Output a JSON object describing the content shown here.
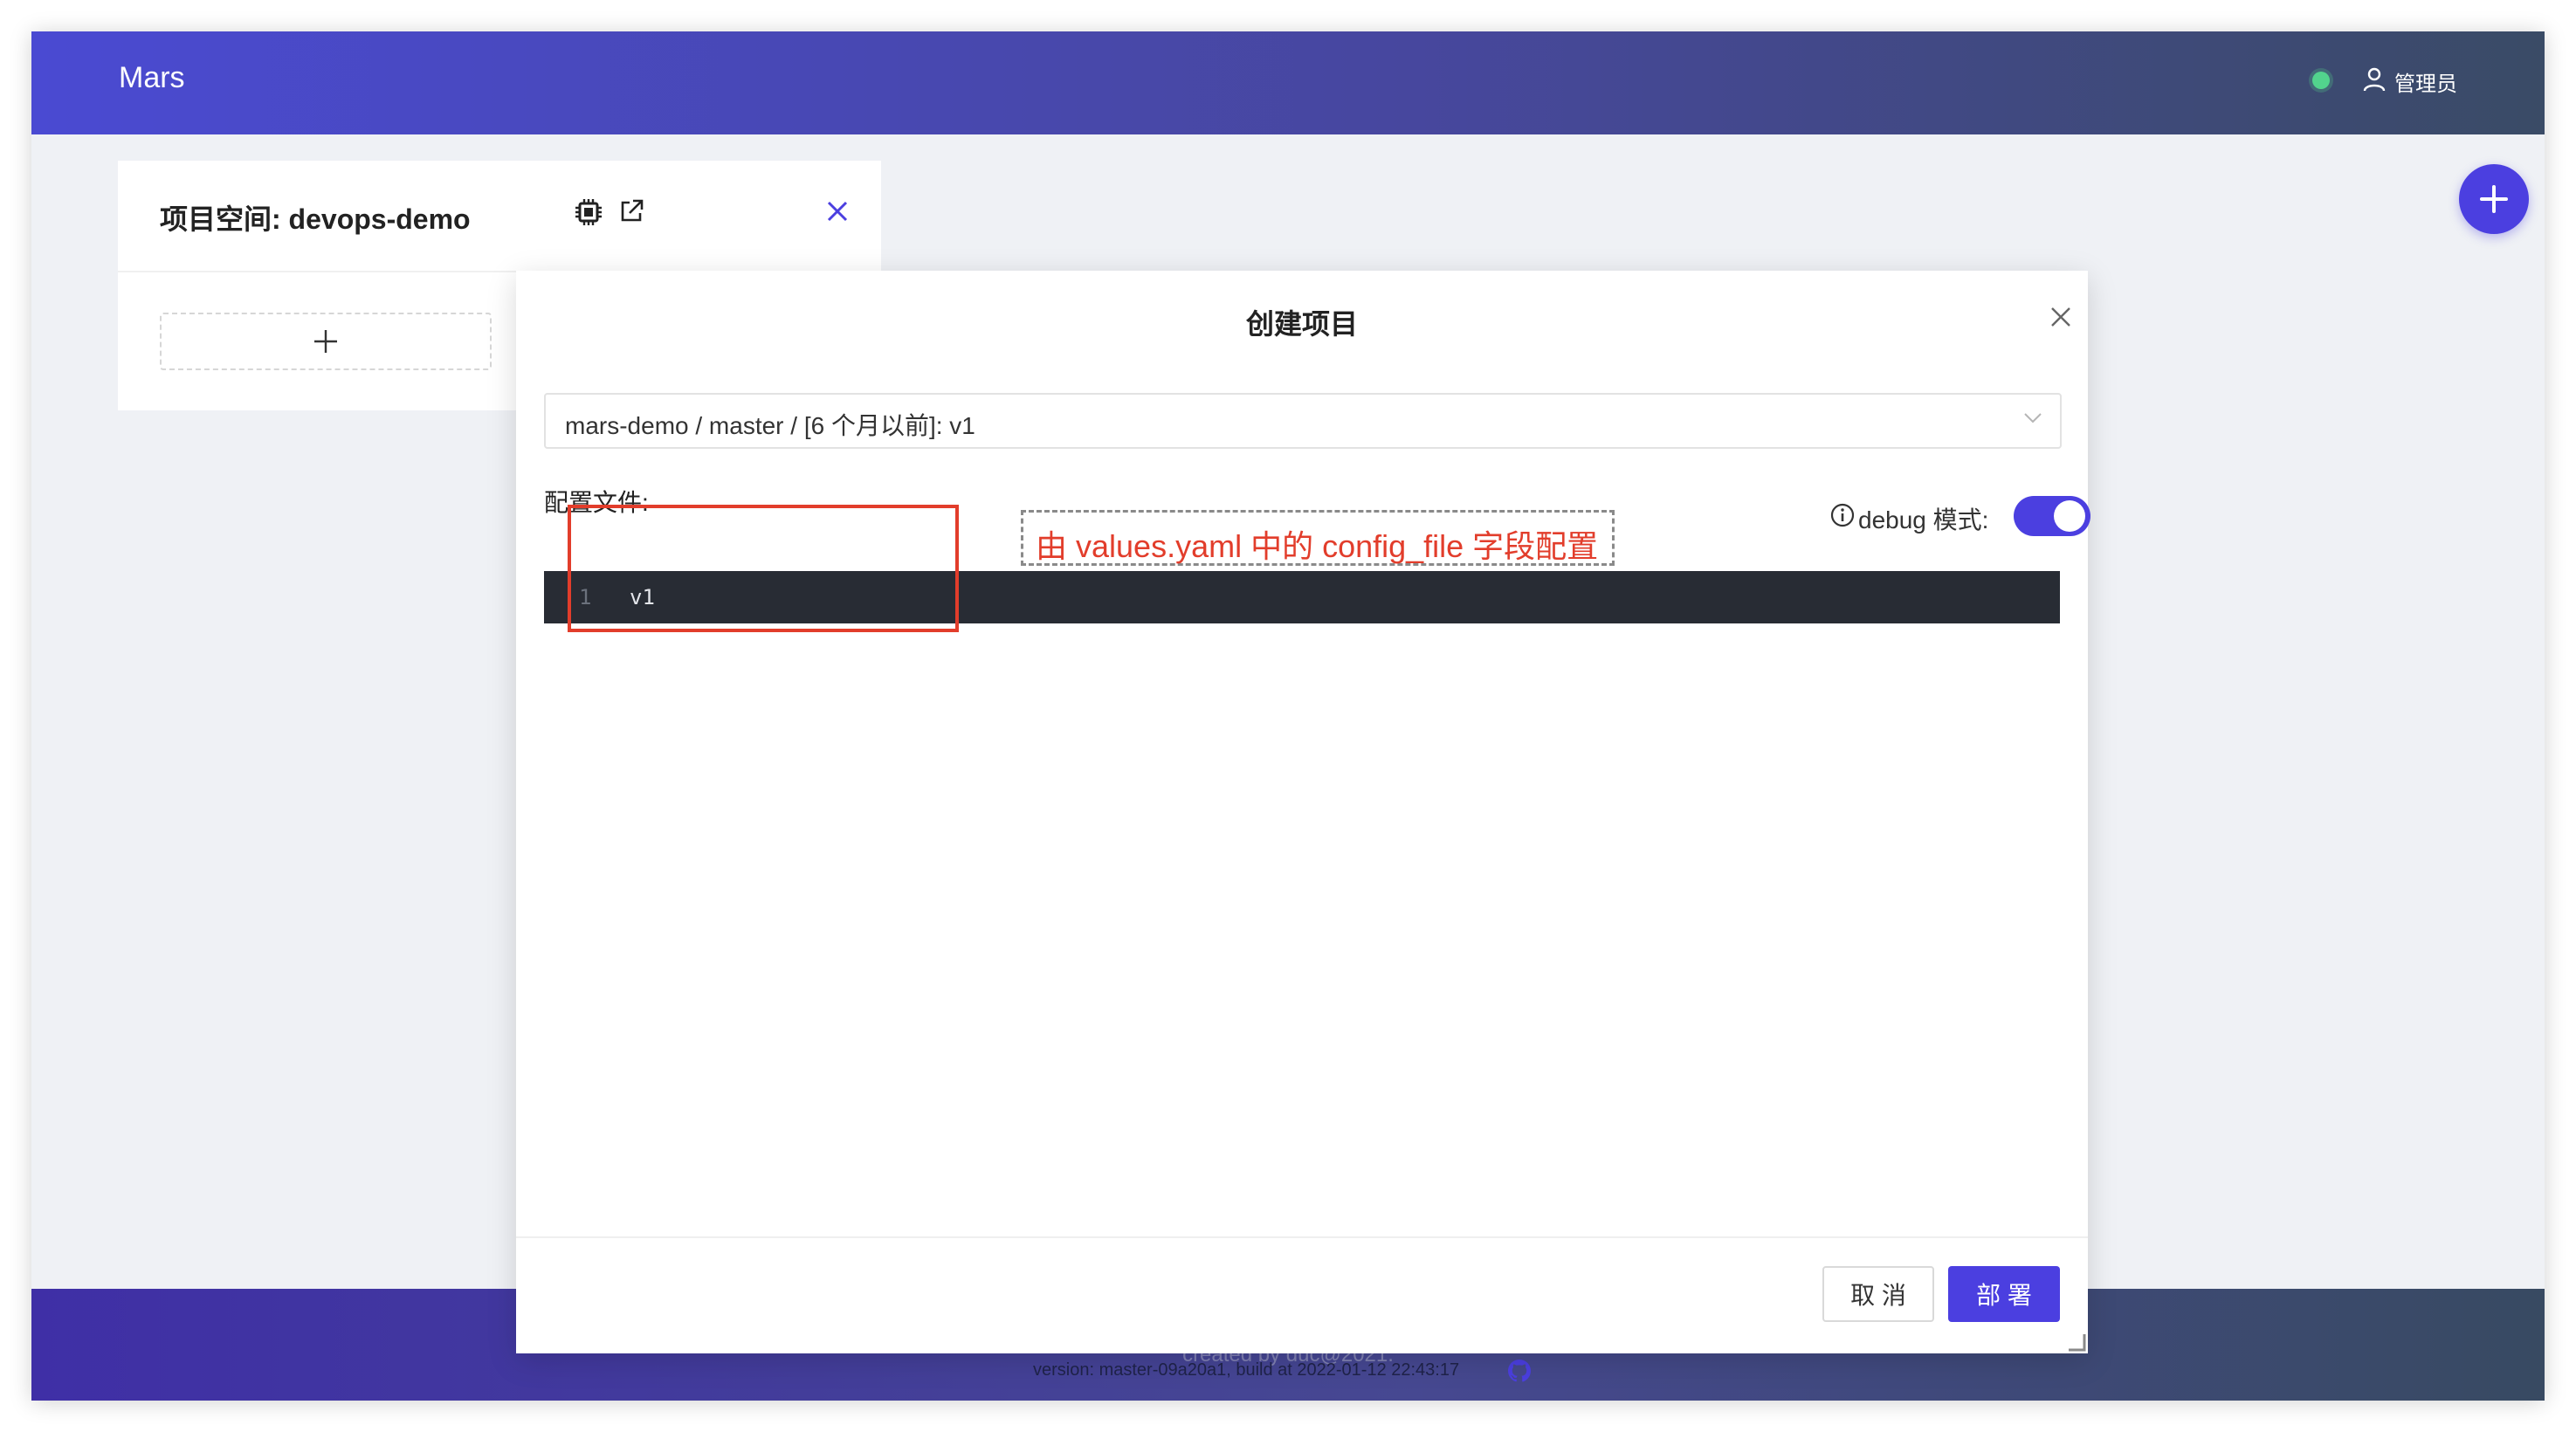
{
  "header": {
    "app_title": "Mars",
    "status_color": "#52d38d",
    "user_icon": "user-icon",
    "user_label": "管理员"
  },
  "namespace_card": {
    "title": "项目空间: devops-demo",
    "icons": [
      "cpu-icon",
      "external-link-icon",
      "close-icon"
    ],
    "add_icon": "plus-icon"
  },
  "fab": {
    "icon": "plus-icon"
  },
  "modal": {
    "title": "创建项目",
    "project_select_value": "mars-demo / master / [6 个月以前]: v1",
    "config_label": "配置文件:",
    "debug_label": "debug 模式:",
    "debug_enabled": true,
    "editor": {
      "lines": [
        {
          "number": "1",
          "code": "v1"
        }
      ]
    },
    "cancel_label": "取 消",
    "deploy_label": "部 署"
  },
  "annotation": {
    "note": "由 values.yaml 中的 config_file 字段配置"
  },
  "footer": {
    "created": "created by duc@2021.",
    "version": "version: master-09a20a1, build at 2022-01-12 22:43:17",
    "icon": "github-icon"
  },
  "colors": {
    "accent": "#4b3fe0",
    "annotation_red": "#e23d2b",
    "editor_bg": "#282c34"
  }
}
